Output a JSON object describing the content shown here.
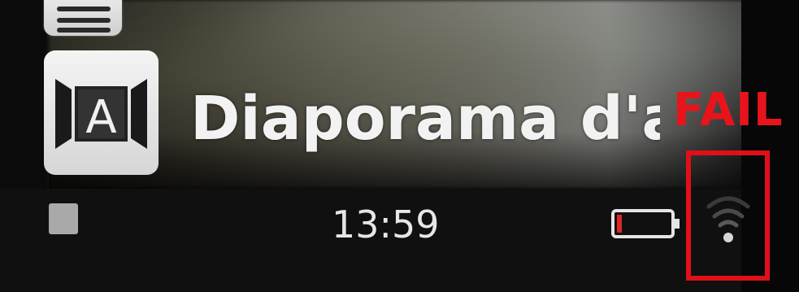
{
  "slideshow": {
    "title": "Diaporama d'app"
  },
  "status_bar": {
    "time": "13:59",
    "battery_level": 0.1
  },
  "annotation": {
    "label": "FAIL",
    "color": "#e8141c"
  },
  "icons": {
    "menu": "menu-icon",
    "auto_mode": "auto-mode-icon",
    "battery": "battery-low-icon",
    "wifi": "wifi-icon",
    "status_square": "stop-square-icon"
  },
  "auto_mode": {
    "letter": "A"
  }
}
